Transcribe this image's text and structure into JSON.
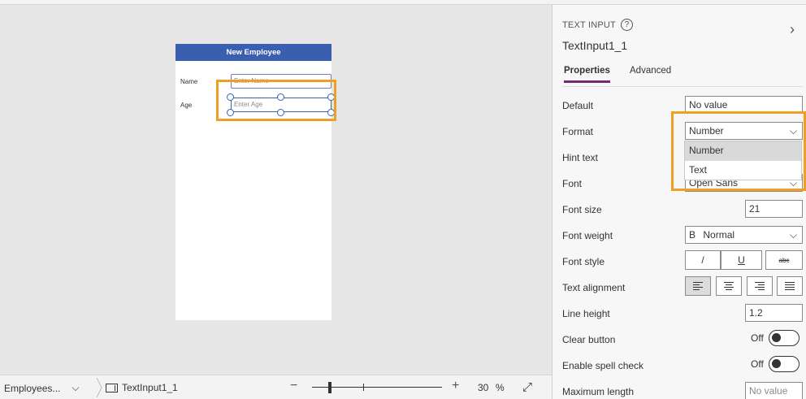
{
  "canvas": {
    "screen_title": "New Employee",
    "fields": [
      {
        "label": "Name",
        "placeholder": "Enter Name"
      },
      {
        "label": "Age",
        "placeholder": "Enter Age"
      }
    ]
  },
  "panel": {
    "kind": "TEXT INPUT",
    "help_icon": "?",
    "control_name": "TextInput1_1",
    "tabs": [
      "Properties",
      "Advanced"
    ],
    "properties": {
      "default": {
        "label": "Default",
        "value": "No value"
      },
      "format": {
        "label": "Format",
        "value": "Number",
        "options": [
          "Number",
          "Text"
        ]
      },
      "hint_text": {
        "label": "Hint text"
      },
      "font": {
        "label": "Font",
        "value": "Open Sans"
      },
      "font_size": {
        "label": "Font size",
        "value": "21"
      },
      "font_weight": {
        "label": "Font weight",
        "icon_text": "B",
        "value": "Normal"
      },
      "font_style": {
        "label": "Font style",
        "italic": "/",
        "underline": "U",
        "strike": "abc"
      },
      "text_alignment": {
        "label": "Text alignment"
      },
      "line_height": {
        "label": "Line height",
        "value": "1.2"
      },
      "clear_button": {
        "label": "Clear button",
        "state": "Off"
      },
      "enable_spell_check": {
        "label": "Enable spell check",
        "state": "Off"
      },
      "maximum_length": {
        "label": "Maximum length",
        "placeholder": "No value"
      }
    }
  },
  "bottom_bar": {
    "screen": "Employees...",
    "control": "TextInput1_1",
    "zoom_minus": "−",
    "zoom_plus": "+",
    "zoom_value": "30",
    "zoom_unit": "%",
    "zoom_level": 0.3
  },
  "colors": {
    "header_blue": "#3b5fb0",
    "highlight_orange": "#f0a020",
    "tab_accent": "#742774"
  }
}
